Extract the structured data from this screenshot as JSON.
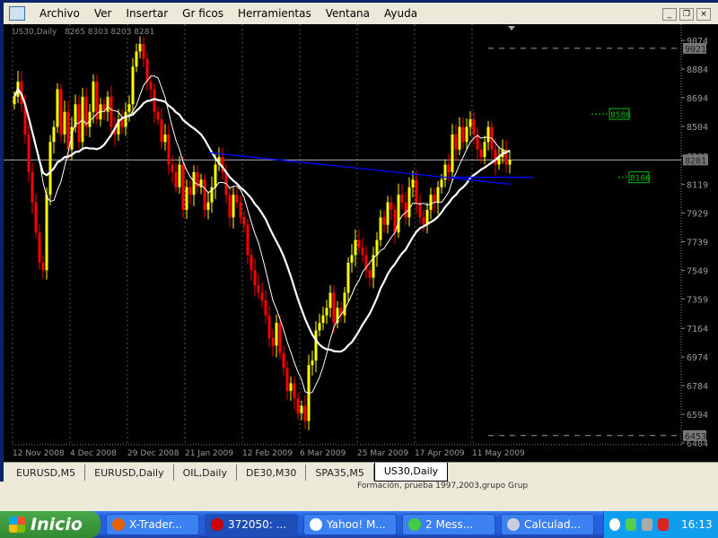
{
  "menu": [
    "Archivo",
    "Ver",
    "Insertar",
    "Gr ficos",
    "Herramientas",
    "Ventana",
    "Ayuda"
  ],
  "chart_header": {
    "symbol": "US30,Daily",
    "ohlc": "8265 8303 8203 8281"
  },
  "colors": {
    "bull": "#ffff00",
    "bear": "#ff0000",
    "trendline": "#0000ff",
    "label": "#00c000",
    "axis": "#9a9a9a",
    "ma": "#ffffff"
  },
  "chart_data": {
    "type": "candlestick",
    "price_ticks": [
      9074,
      8884,
      8694,
      8504,
      8308,
      8119,
      7929,
      7739,
      7549,
      7359,
      7164,
      6974,
      6784,
      6594,
      6404
    ],
    "ylim": [
      6404,
      9074
    ],
    "date_ticks": [
      "12 Nov 2008",
      "4 Dec 2008",
      "29 Dec 2008",
      "21 Jan 2009",
      "12 Feb 2009",
      "6 Mar 2009",
      "25 Mar 2009",
      "17 Apr 2009",
      "11 May 2009"
    ],
    "closes": [
      8700,
      8800,
      8650,
      8450,
      8200,
      8000,
      7800,
      7600,
      7550,
      8050,
      8400,
      8500,
      8750,
      8450,
      8600,
      8350,
      8500,
      8650,
      8400,
      8700,
      8500,
      8600,
      8800,
      8550,
      8650,
      8600,
      8700,
      8500,
      8450,
      8550,
      8500,
      8600,
      8650,
      8900,
      9000,
      9050,
      8950,
      8800,
      8750,
      8600,
      8550,
      8400,
      8450,
      8250,
      8200,
      8100,
      8250,
      7950,
      8100,
      8050,
      8200,
      8100,
      8150,
      7950,
      8000,
      8100,
      8250,
      8300,
      8200,
      8050,
      7900,
      8050,
      8000,
      7900,
      7850,
      7650,
      7550,
      7450,
      7400,
      7350,
      7250,
      7100,
      7050,
      7200,
      7000,
      6900,
      6750,
      6800,
      6700,
      6600,
      6650,
      6550,
      6920,
      6950,
      7150,
      7200,
      7250,
      7300,
      7400,
      7200,
      7300,
      7250,
      7400,
      7600,
      7650,
      7750,
      7700,
      7650,
      7550,
      7500,
      7650,
      7750,
      7900,
      7850,
      8000,
      7950,
      7800,
      8050,
      8000,
      7900,
      8100,
      8150,
      8000,
      7900,
      7850,
      7950,
      8050,
      8000,
      8100,
      8150,
      8250,
      8200,
      8450,
      8350,
      8500,
      8400,
      8500,
      8550,
      8450,
      8350,
      8300,
      8400,
      8500,
      8350,
      8250,
      8300,
      8350,
      8250,
      8281
    ],
    "last_price": 8281,
    "high_level": 9021,
    "low_level": 6453,
    "labels": [
      {
        "text": "8586",
        "price": 8586
      },
      {
        "text": "8166",
        "price": 8166
      }
    ]
  },
  "tabs": [
    {
      "label": "EURUSD,M5"
    },
    {
      "label": "EURUSD,Daily"
    },
    {
      "label": "OIL,Daily"
    },
    {
      "label": "DE30,M30"
    },
    {
      "label": "SPA35,M5"
    },
    {
      "label": "US30,Daily",
      "active": true
    }
  ],
  "below_text": "Formación, prueba 1997,2003,grupo Grup",
  "taskbar": {
    "start": "Inicio",
    "tasks": [
      {
        "label": "X-Trader...",
        "color": "#e66000"
      },
      {
        "label": "372050: ...",
        "color": "#c00",
        "active": true
      },
      {
        "label": "Yahoo! M...",
        "color": "#fff"
      },
      {
        "label": "2 Mess...",
        "color": "#4c4"
      },
      {
        "label": "Calculad...",
        "color": "#ccd"
      }
    ],
    "clock": "16:13"
  }
}
